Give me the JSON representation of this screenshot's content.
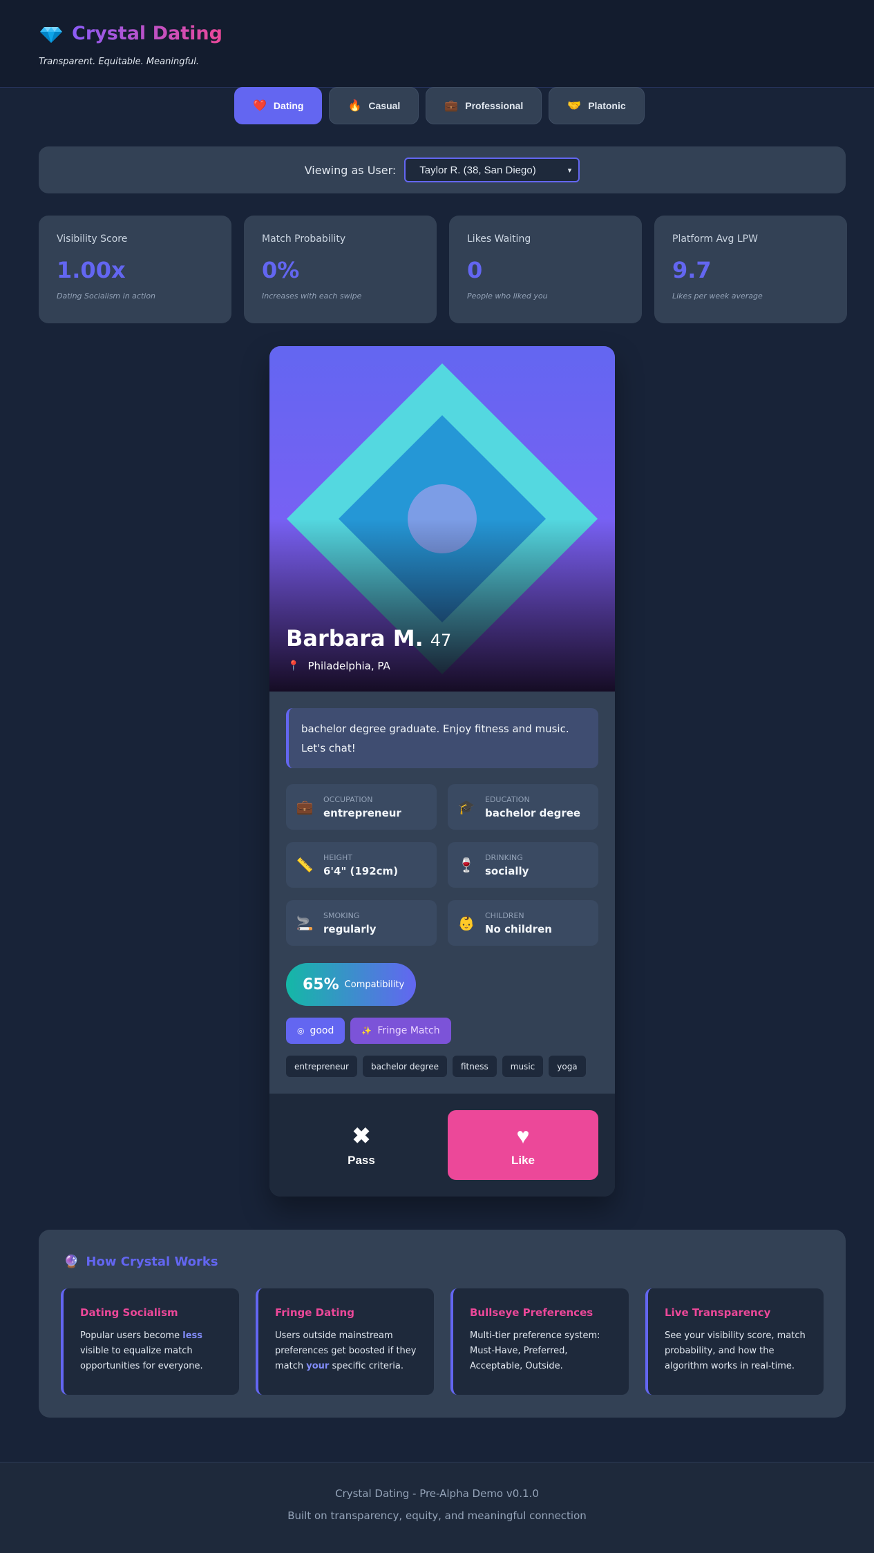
{
  "header": {
    "title": "Crystal Dating",
    "tagline": "Transparent. Equitable. Meaningful.",
    "logo_icon": "gem-icon"
  },
  "tabs": [
    {
      "label": "Dating",
      "icon": "❤️",
      "active": true
    },
    {
      "label": "Casual",
      "icon": "🔥",
      "active": false
    },
    {
      "label": "Professional",
      "icon": "💼",
      "active": false
    },
    {
      "label": "Platonic",
      "icon": "🤝",
      "active": false
    }
  ],
  "viewer": {
    "label": "Viewing as User:",
    "selected": "Taylor R. (38, San Diego)"
  },
  "stats": [
    {
      "label": "Visibility Score",
      "value": "1.00x",
      "sub": "Dating Socialism in action"
    },
    {
      "label": "Match Probability",
      "value": "0%",
      "sub": "Increases with each swipe"
    },
    {
      "label": "Likes Waiting",
      "value": "0",
      "sub": "People who liked you"
    },
    {
      "label": "Platform Avg LPW",
      "value": "9.7",
      "sub": "Likes per week average"
    }
  ],
  "profile": {
    "name": "Barbara M.",
    "age": "47",
    "location": "Philadelphia, PA",
    "bio": "bachelor degree graduate. Enjoy fitness and music. Let's chat!",
    "details": [
      {
        "label": "Occupation",
        "value": "entrepreneur",
        "icon": "💼"
      },
      {
        "label": "Education",
        "value": "bachelor degree",
        "icon": "🎓"
      },
      {
        "label": "Height",
        "value": "6'4\" (192cm)",
        "icon": "📏"
      },
      {
        "label": "Drinking",
        "value": "socially",
        "icon": "🍷"
      },
      {
        "label": "Smoking",
        "value": "regularly",
        "icon": "🚬"
      },
      {
        "label": "Children",
        "value": "No children",
        "icon": "👶"
      }
    ],
    "compatibility": {
      "percent": "65%",
      "label": "Compatibility"
    },
    "badges": [
      {
        "label": "good",
        "icon": "◎"
      },
      {
        "label": "Fringe Match",
        "icon": "✨"
      }
    ],
    "tags": [
      "entrepreneur",
      "bachelor degree",
      "fitness",
      "music",
      "yoga"
    ]
  },
  "actions": {
    "pass_label": "Pass",
    "like_label": "Like"
  },
  "how": {
    "title": "How Crystal Works",
    "cards": [
      {
        "title": "Dating Socialism",
        "pre": "Popular users become ",
        "hl": "less",
        "post": " visible to equalize match opportunities for everyone."
      },
      {
        "title": "Fringe Dating",
        "pre": "Users outside mainstream preferences get boosted if they match ",
        "hl": "your",
        "post": " specific criteria."
      },
      {
        "title": "Bullseye Preferences",
        "pre": "Multi-tier preference system: Must-Have, Preferred, Acceptable, Outside.",
        "hl": "",
        "post": ""
      },
      {
        "title": "Live Transparency",
        "pre": "See your visibility score, match probability, and how the algorithm works in real-time.",
        "hl": "",
        "post": ""
      }
    ]
  },
  "footer": {
    "line1": "Crystal Dating - Pre-Alpha Demo v0.1.0",
    "line2": "Built on transparency, equity, and meaningful connection"
  },
  "colors": {
    "accent": "#6366f1",
    "pink": "#ec4899",
    "teal": "#14b8a6"
  }
}
